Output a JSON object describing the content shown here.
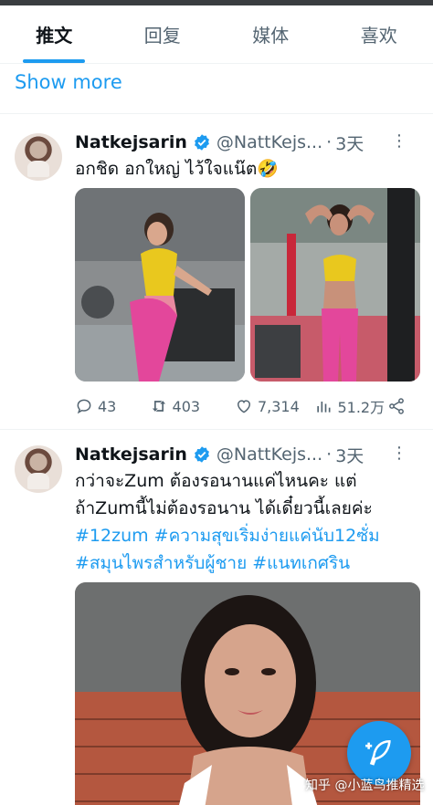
{
  "tabs": [
    {
      "label": "推文",
      "active": true
    },
    {
      "label": "回复",
      "active": false
    },
    {
      "label": "媒体",
      "active": false
    },
    {
      "label": "喜欢",
      "active": false
    }
  ],
  "show_more": "Show more",
  "tweets": [
    {
      "name": "Natkejsarin",
      "handle": "@NattKejs...",
      "separator": "·",
      "time": "3天",
      "text": "อกชิด อกใหญ่ ไว้ใจแน๊ต🤣",
      "replies": "43",
      "retweets": "403",
      "likes": "7,314",
      "views": "51.2万"
    },
    {
      "name": "Natkejsarin",
      "handle": "@NattKejs...",
      "separator": "·",
      "time": "3天",
      "text_line1": "กว่าจะZum ต้องรอนานแค่ไหนคะ แต่",
      "text_line2": "ถ้าZumนี้ไม่ต้องรอนาน ได้เดี๋ยวนี้เลยค่ะ",
      "hashtags_line1": "#12zum #ความสุขเริ่มง่ายแค่นับ12ซั่ม",
      "hashtags_line2": "#สมุนไพรสำหรับผู้ชาย #แนทเกศริน"
    }
  ],
  "watermark": "知乎 @小蓝鸟推精选",
  "colors": {
    "accent": "#1d9bf0",
    "text": "#0f1419",
    "muted": "#536471"
  }
}
